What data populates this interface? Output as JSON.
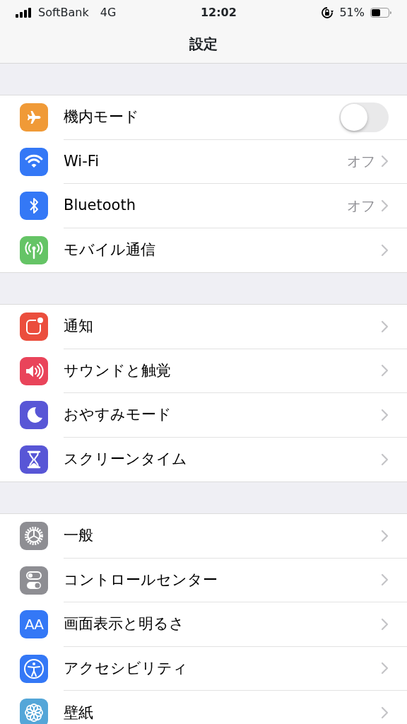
{
  "status_bar": {
    "carrier": "SoftBank",
    "network": "4G",
    "time": "12:02",
    "battery_percent": "51%"
  },
  "nav_bar": {
    "title": "設定"
  },
  "sections": [
    {
      "items": [
        {
          "color": "#f09a37",
          "label": "機内モード",
          "kind": "toggle",
          "on": false
        },
        {
          "color": "#3478f6",
          "label": "Wi-Fi",
          "kind": "link",
          "value": "オフ"
        },
        {
          "color": "#3478f6",
          "label": "Bluetooth",
          "kind": "link",
          "value": "オフ"
        },
        {
          "color": "#65c466",
          "label": "モバイル通信",
          "kind": "link"
        }
      ]
    },
    {
      "items": [
        {
          "color": "#eb4e3d",
          "label": "通知",
          "kind": "link"
        },
        {
          "color": "#e9445a",
          "label": "サウンドと触覚",
          "kind": "link"
        },
        {
          "color": "#5856d6",
          "label": "おやすみモード",
          "kind": "link"
        },
        {
          "color": "#5856d6",
          "label": "スクリーンタイム",
          "kind": "link"
        }
      ]
    },
    {
      "items": [
        {
          "color": "#8e8e93",
          "label": "一般",
          "kind": "link"
        },
        {
          "color": "#8e8e93",
          "label": "コントロールセンター",
          "kind": "link"
        },
        {
          "icon_text": "AA",
          "color": "#3478f6",
          "label": "画面表示と明るさ",
          "kind": "link"
        },
        {
          "color": "#3478f6",
          "label": "アクセシビリティ",
          "kind": "link"
        },
        {
          "color": "#54a6d8",
          "label": "壁紙",
          "kind": "link"
        }
      ]
    }
  ]
}
